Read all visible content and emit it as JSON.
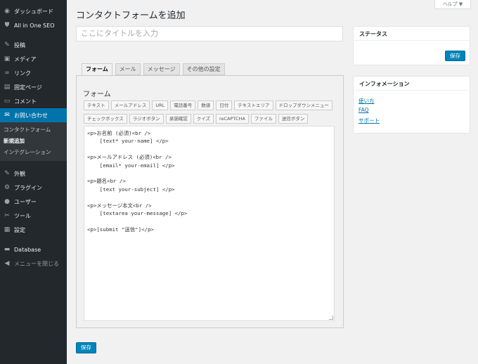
{
  "sidebar": {
    "top_items": [
      {
        "label": "ダッシュボード",
        "icon": "dashboard-icon",
        "glyph": "◉"
      },
      {
        "label": "All in One SEO",
        "icon": "seo-icon",
        "glyph": "⛊"
      }
    ],
    "items": [
      {
        "label": "投稿",
        "icon": "pin-icon",
        "glyph": "✎"
      },
      {
        "label": "メディア",
        "icon": "media-icon",
        "glyph": "▣"
      },
      {
        "label": "リンク",
        "icon": "link-icon",
        "glyph": "∞"
      },
      {
        "label": "固定ページ",
        "icon": "page-icon",
        "glyph": "▤"
      },
      {
        "label": "コメント",
        "icon": "comment-icon",
        "glyph": "▭"
      },
      {
        "label": "お問い合わせ",
        "icon": "mail-icon",
        "glyph": "✉"
      }
    ],
    "submenu": [
      {
        "label": "コンタクトフォーム"
      },
      {
        "label": "新規追加"
      },
      {
        "label": "インテグレーション"
      }
    ],
    "lower_items": [
      {
        "label": "外観",
        "icon": "appearance-icon",
        "glyph": "✎"
      },
      {
        "label": "プラグイン",
        "icon": "plugin-icon",
        "glyph": "⚙"
      },
      {
        "label": "ユーザー",
        "icon": "user-icon",
        "glyph": "●"
      },
      {
        "label": "ツール",
        "icon": "tool-icon",
        "glyph": "✂"
      },
      {
        "label": "設定",
        "icon": "settings-icon",
        "glyph": "▦"
      }
    ],
    "database": {
      "label": "Database",
      "icon": "database-icon",
      "glyph": "▬"
    },
    "collapse": {
      "label": "メニューを閉じる",
      "icon": "collapse-icon",
      "glyph": "◀"
    }
  },
  "help_tab": "ヘルプ ▼",
  "page_title": "コンタクトフォームを追加",
  "title_placeholder": "ここにタイトルを入力",
  "tabs": [
    "フォーム",
    "メール",
    "メッセージ",
    "その他の設定"
  ],
  "form": {
    "heading": "フォーム",
    "tag_row1": [
      "テキスト",
      "メールアドレス",
      "URL",
      "電話番号",
      "数値",
      "日付",
      "テキストエリア",
      "ドロップダウンメニュー"
    ],
    "tag_row2": [
      "チェックボックス",
      "ラジオボタン",
      "承諾確認",
      "クイズ",
      "reCAPTCHA",
      "ファイル",
      "送信ボタン"
    ],
    "template": "<p>お名前 (必須)<br />\n    [text* your-name] </p>\n\n<p>メールアドレス (必須)<br />\n    [email* your-email] </p>\n\n<p>題名<br />\n    [text your-subject] </p>\n\n<p>メッセージ本文<br />\n    [textarea your-message] </p>\n\n<p>[submit \"送信\"]</p>"
  },
  "save_label": "保存",
  "status_box": {
    "title": "ステータス",
    "save_label": "保存"
  },
  "info_box": {
    "title": "インフォメーション",
    "links": [
      "使い方",
      "FAQ",
      "サポート"
    ]
  },
  "colors": {
    "sidebar": "#23282d",
    "accent": "#0073aa",
    "button": "#0085ba"
  }
}
